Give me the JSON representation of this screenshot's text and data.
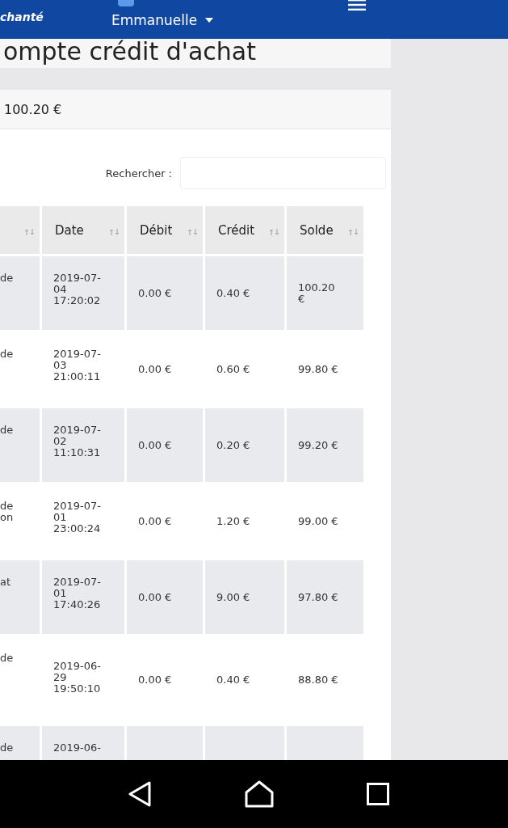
{
  "header": {
    "brand": "chanté",
    "user": "Emmanuelle"
  },
  "page_title": "ompte crédit d'achat",
  "balance": "100.20 €",
  "search": {
    "label": "Rechercher :"
  },
  "table": {
    "columns": [
      {
        "sortable": true
      },
      {
        "label": "Date",
        "sortable": true
      },
      {
        "label": "Débit",
        "sortable": true
      },
      {
        "label": "Crédit",
        "sortable": true
      },
      {
        "label": "Solde",
        "sortable": true
      }
    ],
    "rows": [
      {
        "cells": [
          "de",
          "2019-07-\n04\n17:20:02",
          "0.00 €",
          "0.40 €",
          "100.20\n€"
        ]
      },
      {
        "cells": [
          "de",
          "2019-07-\n03\n21:00:11",
          "0.00 €",
          "0.60 €",
          "99.80 €"
        ]
      },
      {
        "cells": [
          "de",
          "2019-07-\n02\n11:10:31",
          "0.00 €",
          "0.20 €",
          "99.20 €"
        ]
      },
      {
        "cells": [
          "de\non",
          "2019-07-\n01\n23:00:24",
          "0.00 €",
          "1.20 €",
          "99.00 €"
        ]
      },
      {
        "cells": [
          "at",
          "2019-07-\n01\n17:40:26",
          "0.00 €",
          "9.00 €",
          "97.80 €"
        ]
      },
      {
        "cells": [
          "de",
          "2019-06-\n29\n19:50:10",
          "0.00 €",
          "0.40 €",
          "88.80 €"
        ]
      },
      {
        "cells": [
          "de",
          "2019-06-",
          "",
          "",
          ""
        ]
      }
    ]
  }
}
